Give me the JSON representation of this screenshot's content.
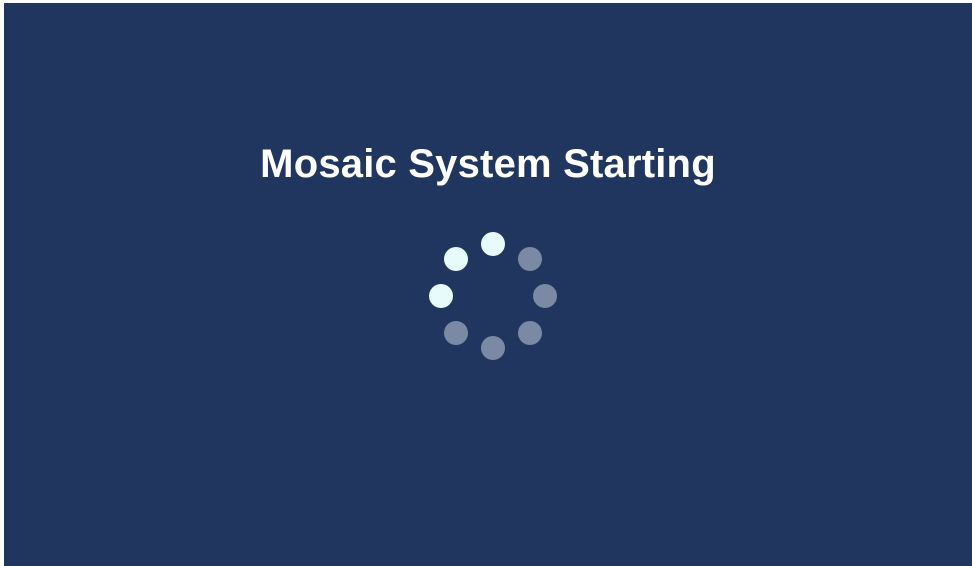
{
  "screen": {
    "title": "Mosaic System Starting"
  },
  "spinner": {
    "dot_count": 8,
    "active_color": "#e8fbfb",
    "inactive_color": "#7a8aa5",
    "active_dots": [
      7,
      0,
      6
    ]
  }
}
